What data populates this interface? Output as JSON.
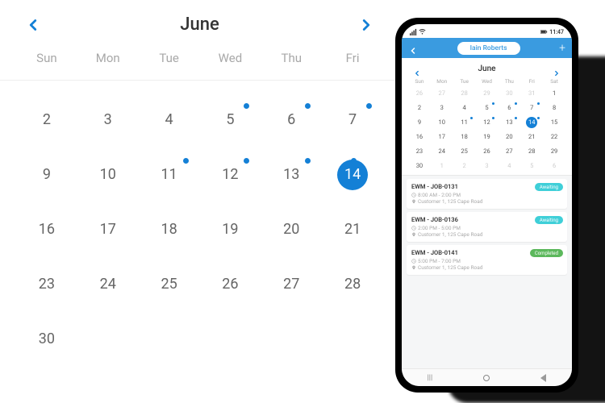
{
  "desktop_calendar": {
    "month": "June",
    "dow": [
      "Sun",
      "Mon",
      "Tue",
      "Wed",
      "Thu",
      "Fri"
    ],
    "cells": [
      {
        "n": "2"
      },
      {
        "n": "3"
      },
      {
        "n": "4"
      },
      {
        "n": "5",
        "dot": true
      },
      {
        "n": "6",
        "dot": true
      },
      {
        "n": "7",
        "dot": true
      },
      {
        "n": "9"
      },
      {
        "n": "10"
      },
      {
        "n": "11",
        "dot": true
      },
      {
        "n": "12",
        "dot": true
      },
      {
        "n": "13",
        "dot": true
      },
      {
        "n": "14",
        "dot": true,
        "sel": true
      },
      {
        "n": "16"
      },
      {
        "n": "17"
      },
      {
        "n": "18"
      },
      {
        "n": "19"
      },
      {
        "n": "20"
      },
      {
        "n": "21"
      },
      {
        "n": "23"
      },
      {
        "n": "24"
      },
      {
        "n": "25"
      },
      {
        "n": "26"
      },
      {
        "n": "27"
      },
      {
        "n": "28"
      },
      {
        "n": "30"
      },
      {
        "n": ""
      },
      {
        "n": ""
      },
      {
        "n": ""
      },
      {
        "n": ""
      },
      {
        "n": ""
      }
    ]
  },
  "phone": {
    "status_time": "11:47",
    "header_user": "Iain Roberts",
    "calendar": {
      "month": "June",
      "dow": [
        "Sun",
        "Mon",
        "Tue",
        "Wed",
        "Thu",
        "Fri",
        "Sat"
      ],
      "cells": [
        {
          "n": "26",
          "dim": true
        },
        {
          "n": "27",
          "dim": true
        },
        {
          "n": "28",
          "dim": true
        },
        {
          "n": "29",
          "dim": true
        },
        {
          "n": "30",
          "dim": true
        },
        {
          "n": "31",
          "dim": true
        },
        {
          "n": "1"
        },
        {
          "n": "2"
        },
        {
          "n": "3"
        },
        {
          "n": "4"
        },
        {
          "n": "5",
          "dot": true
        },
        {
          "n": "6",
          "dot": true
        },
        {
          "n": "7",
          "dot": true
        },
        {
          "n": "8"
        },
        {
          "n": "9"
        },
        {
          "n": "10"
        },
        {
          "n": "11",
          "dot": true
        },
        {
          "n": "12",
          "dot": true
        },
        {
          "n": "13",
          "dot": true
        },
        {
          "n": "14",
          "dot": true,
          "sel": true
        },
        {
          "n": "15"
        },
        {
          "n": "16"
        },
        {
          "n": "17"
        },
        {
          "n": "18"
        },
        {
          "n": "19"
        },
        {
          "n": "20"
        },
        {
          "n": "21"
        },
        {
          "n": "22"
        },
        {
          "n": "23"
        },
        {
          "n": "24"
        },
        {
          "n": "25"
        },
        {
          "n": "26"
        },
        {
          "n": "27"
        },
        {
          "n": "28"
        },
        {
          "n": "29"
        },
        {
          "n": "30"
        },
        {
          "n": "1",
          "dim": true
        },
        {
          "n": "2",
          "dim": true
        },
        {
          "n": "3",
          "dim": true
        },
        {
          "n": "4",
          "dim": true
        },
        {
          "n": "5",
          "dim": true
        },
        {
          "n": "6",
          "dim": true
        }
      ]
    },
    "jobs": [
      {
        "title": "EWM - JOB-0131",
        "time": "8:00 AM - 2:00 PM",
        "loc": "Customer 1, 125 Cape Road",
        "status": "Awaiting",
        "status_class": "badge-await"
      },
      {
        "title": "EWM - JOB-0136",
        "time": "2:00 PM - 5:00 PM",
        "loc": "Customer 1, 125 Cape Road",
        "status": "Awaiting",
        "status_class": "badge-await"
      },
      {
        "title": "EWM - JOB-0141",
        "time": "5:00 PM - 7:00 PM",
        "loc": "Customer 1, 125 Cape Road",
        "status": "Completed",
        "status_class": "badge-done"
      }
    ]
  },
  "colors": {
    "accent": "#1480d6"
  }
}
